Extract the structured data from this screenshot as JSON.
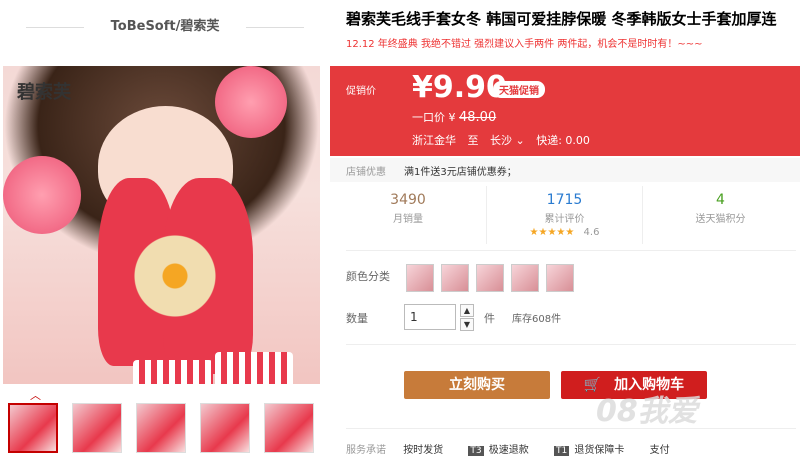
{
  "shop": {
    "name": "ToBeSoft/碧索芙"
  },
  "gallery": {
    "logo_text": "碧索芙",
    "zoom_glyph": "🔍",
    "up_arrow": "︿",
    "thumbnails": [
      "1",
      "2",
      "3",
      "4",
      "5"
    ]
  },
  "product": {
    "title": "碧索芙毛线手套女冬 韩国可爱挂脖保暖 冬季韩版女士手套加厚连",
    "subtitle": "12.12 年终盛典 我绝不错过 强烈建议入手两件 两件起，机会不是时时有！~~~"
  },
  "price": {
    "label": "促销价",
    "current": "¥9.90",
    "badge": "天猫促销",
    "orig_label": "一口价",
    "orig_currency": "¥",
    "orig_value": "48.00",
    "origin": "浙江金华",
    "to": "至",
    "dest": "长沙",
    "dest_chevron": "⌄",
    "shipping": "快递: 0.00"
  },
  "coupon": {
    "label": "店铺优惠",
    "text": "满1件送3元店铺优惠券；"
  },
  "stats": {
    "monthly_sales": "3490",
    "monthly_sales_label": "月销量",
    "reviews": "1715",
    "reviews_label": "累计评价",
    "rating_stars": "★★★★★",
    "rating": "4.6",
    "points": "4",
    "points_label": "送天猫积分"
  },
  "options": {
    "color_label": "颜色分类",
    "colors": [
      "1",
      "2",
      "3",
      "4",
      "5"
    ],
    "qty_label": "数量",
    "qty_value": "1",
    "qty_unit": "件",
    "stock": "库存608件",
    "step_up": "▲",
    "step_down": "▼"
  },
  "actions": {
    "buy_now": "立刻购买",
    "add_cart": "加入购物车",
    "cart_icon": "🛒"
  },
  "service": {
    "label": "服务承诺",
    "items": [
      {
        "tag": "",
        "text": "按时发货"
      },
      {
        "tag": "T3",
        "text": "极速退款"
      },
      {
        "tag": "T1",
        "text": "退货保障卡"
      },
      {
        "tag": "",
        "text": "支付"
      }
    ]
  },
  "watermark": "08我爱"
}
